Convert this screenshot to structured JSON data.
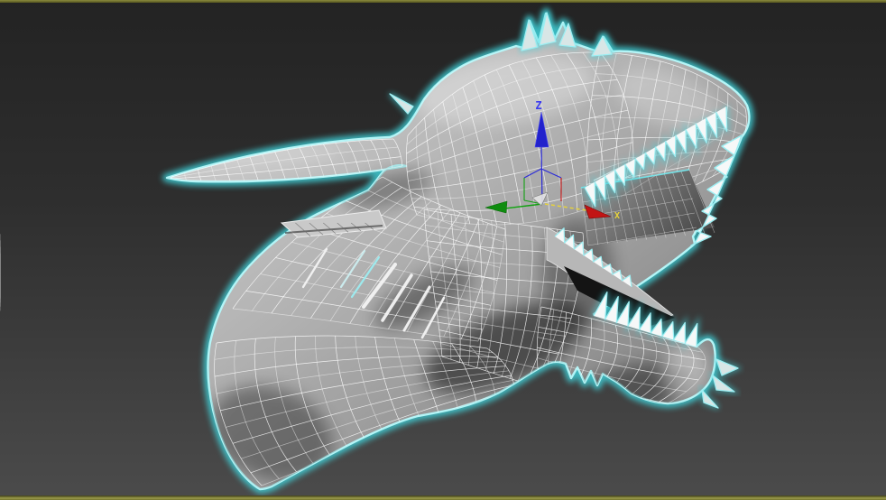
{
  "viewport": {
    "type": "3d-perspective-viewport",
    "border_color": "#7d7d33",
    "background_top": "#242424",
    "background_bottom": "#4b4b4b",
    "selection_color": "#6fe8ee"
  },
  "model": {
    "label": "dragon-head-wireframe",
    "wire_color": "#ffffff",
    "selected": true
  },
  "gizmo": {
    "tool": "select-and-move",
    "z_label": "Z",
    "x_label": "X",
    "x_color": "#c21414",
    "y_color": "#12a012",
    "z_color": "#2a2ad8",
    "highlight_color": "#e6d23c"
  }
}
